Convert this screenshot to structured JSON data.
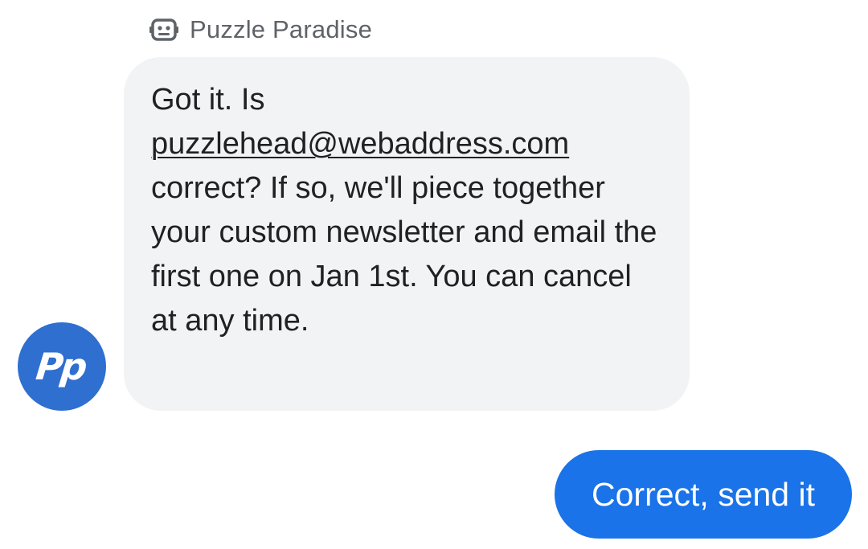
{
  "sender": {
    "name": "Puzzle Paradise",
    "icon": "robot-icon"
  },
  "avatar": {
    "logo_text": "Pp",
    "color": "#2f6fcf"
  },
  "message": {
    "text_before": "Got it. Is",
    "email": "puzzlehead@webaddress.com",
    "text_after": "correct? If so, we'll piece together your custom newsletter and email the first one on Jan 1st. You can cancel at any time.",
    "bubble_color": "#f1f3f4"
  },
  "reply": {
    "label": "Correct, send it",
    "color": "#1a73e8"
  }
}
